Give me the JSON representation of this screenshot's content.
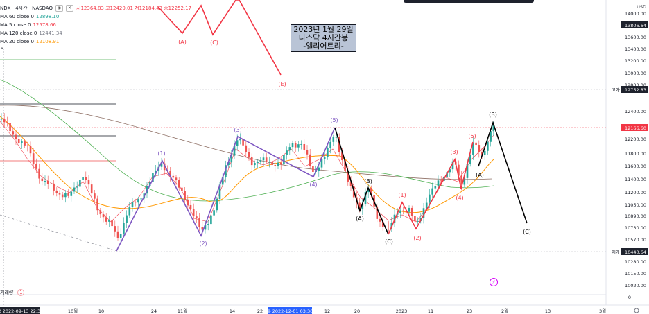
{
  "legend": {
    "title": "NDX · 4시간 · NASDAQ",
    "ohlc": "시12364.83 고12420.01 저12184.43 종12252.17",
    "indicators": [
      {
        "label": "MA 60 close 0",
        "value": "12898.10",
        "color": "#26a69a"
      },
      {
        "label": "MA 5 close 0",
        "value": "12578.66",
        "color": "#f23645"
      },
      {
        "label": "MA 120 close 0",
        "value": "12441.34",
        "color": "#787b86"
      },
      {
        "label": "MA 20 close 0",
        "value": "12108.91",
        "color": "#ff9800"
      }
    ]
  },
  "annotation": {
    "line1": "2023년 1월 29일",
    "line2": "나스닥 4시간봉",
    "line3": "-엘리어트리-"
  },
  "axis": {
    "currency": "USD",
    "ticks": [
      "14000.00",
      "13800.00",
      "13600.00",
      "13400.00",
      "13200.00",
      "13000.00",
      "12800.00",
      "12400.00",
      "12200.00",
      "11800.00",
      "11600.00",
      "11400.00",
      "11200.00",
      "11050.00",
      "10890.00",
      "10730.00",
      "10570.00",
      "10280.00",
      "10150.00",
      "10020.00"
    ],
    "price_label": "13806.64",
    "high_label": "고가",
    "high_value": "12752.83",
    "current_value": "12166.60",
    "low_label": "저가",
    "low_value": "10440.64",
    "zero_label": "0"
  },
  "time_axis": {
    "left_label": "요 2022-09-13   22:30",
    "cursor_label": "목 2022-12-01   03:30",
    "ticks": [
      "10월",
      "10",
      "24",
      "11월",
      "14",
      "22",
      "12",
      "20",
      "2023",
      "11",
      "23",
      "2월",
      "13",
      "3월"
    ]
  },
  "volume": {
    "label": "거래량",
    "badge": "1"
  },
  "waves": {
    "purple": [
      "(1)",
      "(2)",
      "(3)",
      "(4)",
      "(5)"
    ],
    "black": [
      "(A)",
      "(B)",
      "(C)",
      "(A)",
      "(B)",
      "(C)"
    ],
    "red_top": [
      "(A)",
      "(C)",
      "(E)"
    ],
    "red_low": [
      "(1)",
      "(2)",
      "(3)",
      "(4)",
      "(5)"
    ]
  },
  "colors": {
    "up": "#26a69a",
    "down": "#ef5350",
    "purple": "#7e57c2",
    "red": "#f23645",
    "black": "#000000",
    "ma20": "#ff9800",
    "ma60": "#4caf50",
    "ma120": "#787b86"
  }
}
